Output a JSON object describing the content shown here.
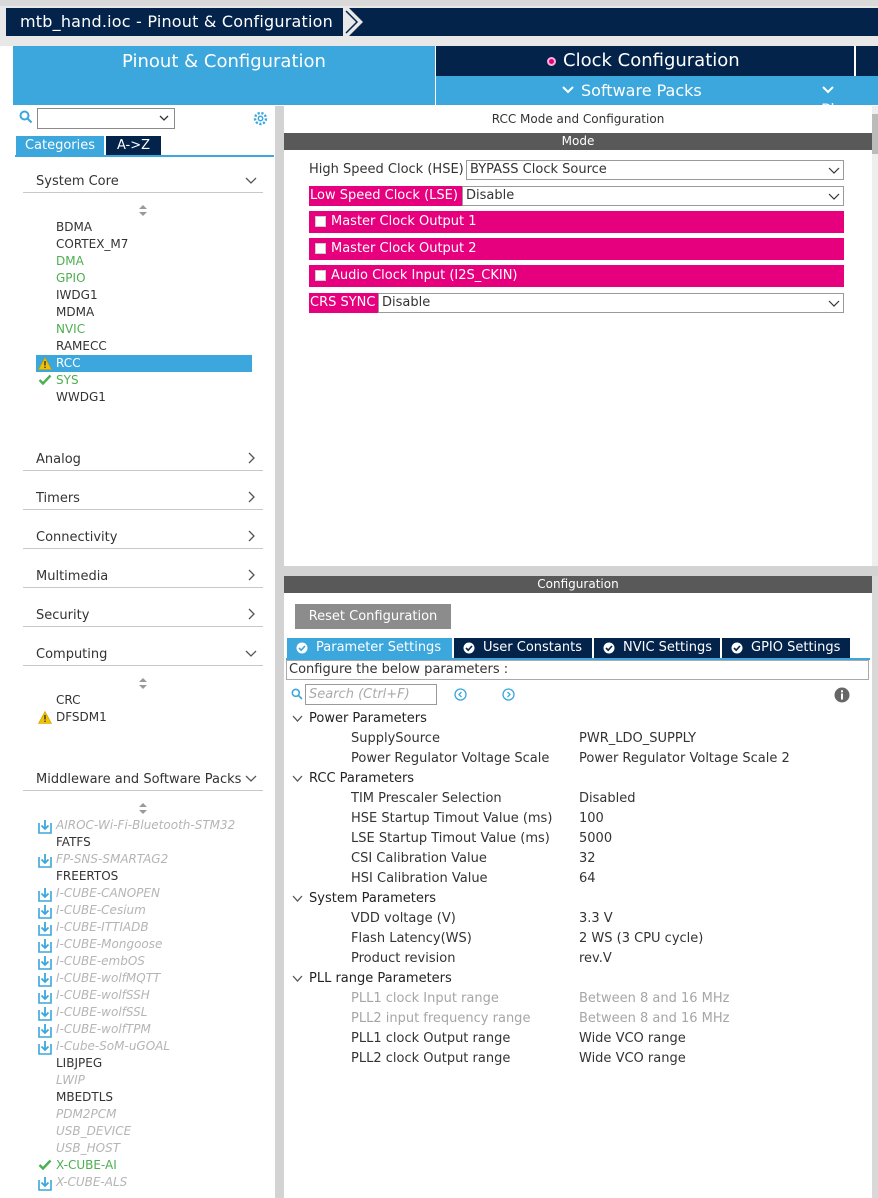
{
  "window": {
    "breadcrumb": "mtb_hand.ioc - Pinout & Configuration"
  },
  "main_tabs": {
    "pinout": "Pinout & Configuration",
    "clock": "Clock Configuration",
    "software_packs": "Software Packs",
    "pinout_short": "Pinou"
  },
  "left_panel": {
    "filter_select_value": "",
    "tab_categories": "Categories",
    "tab_az": "A->Z",
    "sections": {
      "system_core": {
        "title": "System Core",
        "items": [
          {
            "label": "BDMA",
            "status": "normal"
          },
          {
            "label": "CORTEX_M7",
            "status": "normal"
          },
          {
            "label": "DMA",
            "status": "green"
          },
          {
            "label": "GPIO",
            "status": "green"
          },
          {
            "label": "IWDG1",
            "status": "normal"
          },
          {
            "label": "MDMA",
            "status": "normal"
          },
          {
            "label": "NVIC",
            "status": "green"
          },
          {
            "label": "RAMECC",
            "status": "normal"
          },
          {
            "label": "RCC",
            "status": "warning-selected"
          },
          {
            "label": "SYS",
            "status": "check-green"
          },
          {
            "label": "WWDG1",
            "status": "normal"
          }
        ]
      },
      "analog": {
        "title": "Analog"
      },
      "timers": {
        "title": "Timers"
      },
      "connectivity": {
        "title": "Connectivity"
      },
      "multimedia": {
        "title": "Multimedia"
      },
      "security": {
        "title": "Security"
      },
      "computing": {
        "title": "Computing",
        "items": [
          {
            "label": "CRC",
            "status": "normal"
          },
          {
            "label": "DFSDM1",
            "status": "warning"
          }
        ]
      },
      "middleware": {
        "title": "Middleware and Software Packs",
        "items": [
          {
            "label": "AIROC-Wi-Fi-Bluetooth-STM32",
            "status": "download"
          },
          {
            "label": "FATFS",
            "status": "normal"
          },
          {
            "label": "FP-SNS-SMARTAG2",
            "status": "download"
          },
          {
            "label": "FREERTOS",
            "status": "normal"
          },
          {
            "label": "I-CUBE-CANOPEN",
            "status": "download"
          },
          {
            "label": "I-CUBE-Cesium",
            "status": "download"
          },
          {
            "label": "I-CUBE-ITTIADB",
            "status": "download"
          },
          {
            "label": "I-CUBE-Mongoose",
            "status": "download"
          },
          {
            "label": "I-CUBE-embOS",
            "status": "download"
          },
          {
            "label": "I-CUBE-wolfMQTT",
            "status": "download"
          },
          {
            "label": "I-CUBE-wolfSSH",
            "status": "download"
          },
          {
            "label": "I-CUBE-wolfSSL",
            "status": "download"
          },
          {
            "label": "I-CUBE-wolfTPM",
            "status": "download"
          },
          {
            "label": "I-Cube-SoM-uGOAL",
            "status": "download"
          },
          {
            "label": "LIBJPEG",
            "status": "normal"
          },
          {
            "label": "LWIP",
            "status": "gray"
          },
          {
            "label": "MBEDTLS",
            "status": "normal"
          },
          {
            "label": "PDM2PCM",
            "status": "gray"
          },
          {
            "label": "USB_DEVICE",
            "status": "gray"
          },
          {
            "label": "USB_HOST",
            "status": "gray"
          },
          {
            "label": "X-CUBE-AI",
            "status": "check-green"
          },
          {
            "label": "X-CUBE-ALS",
            "status": "download"
          }
        ]
      }
    }
  },
  "mode_panel": {
    "title": "RCC Mode and Configuration",
    "section": "Mode",
    "hse_label": "High Speed Clock (HSE)",
    "hse_value": "BYPASS Clock Source",
    "lse_label": "Low Speed Clock (LSE)",
    "lse_value": "Disable",
    "mco1": "Master Clock Output 1",
    "mco2": "Master Clock Output 2",
    "i2s_ckin": "Audio Clock Input (I2S_CKIN)",
    "crs_label": "CRS SYNC",
    "crs_value": "Disable"
  },
  "config_panel": {
    "section": "Configuration",
    "reset_button": "Reset Configuration",
    "tabs": [
      "Parameter Settings",
      "User Constants",
      "NVIC Settings",
      "GPIO Settings"
    ],
    "configure_text": "Configure the below parameters :",
    "search_placeholder": "Search (Ctrl+F)",
    "groups": [
      {
        "title": "Power Parameters",
        "params": [
          {
            "name": "SupplySource",
            "value": "PWR_LDO_SUPPLY",
            "enabled": true
          },
          {
            "name": "Power Regulator Voltage Scale",
            "value": "Power Regulator Voltage Scale 2",
            "enabled": true
          }
        ]
      },
      {
        "title": "RCC Parameters",
        "params": [
          {
            "name": "TIM Prescaler Selection",
            "value": "Disabled",
            "enabled": true
          },
          {
            "name": "HSE Startup Timout Value (ms)",
            "value": "100",
            "enabled": true
          },
          {
            "name": "LSE Startup Timout Value (ms)",
            "value": "5000",
            "enabled": true
          },
          {
            "name": "CSI Calibration Value",
            "value": "32",
            "enabled": true
          },
          {
            "name": "HSI Calibration Value",
            "value": "64",
            "enabled": true
          }
        ]
      },
      {
        "title": "System Parameters",
        "params": [
          {
            "name": "VDD voltage (V)",
            "value": "3.3 V",
            "enabled": true
          },
          {
            "name": "Flash Latency(WS)",
            "value": "2 WS (3 CPU cycle)",
            "enabled": true
          },
          {
            "name": "Product revision",
            "value": "rev.V",
            "enabled": true
          }
        ]
      },
      {
        "title": "PLL range Parameters",
        "params": [
          {
            "name": "PLL1 clock Input range",
            "value": "Between 8 and 16 MHz",
            "enabled": false
          },
          {
            "name": "PLL2 input frequency range",
            "value": "Between 8 and 16 MHz",
            "enabled": false
          },
          {
            "name": "PLL1 clock Output range",
            "value": "Wide VCO range",
            "enabled": true
          },
          {
            "name": "PLL2 clock Output range",
            "value": "Wide VCO range",
            "enabled": true
          }
        ]
      }
    ]
  },
  "colors": {
    "navy": "#03234b",
    "accent_blue": "#3ba7dc",
    "pink": "#e6007e",
    "green": "#4caf50",
    "header_gray": "#595959"
  }
}
